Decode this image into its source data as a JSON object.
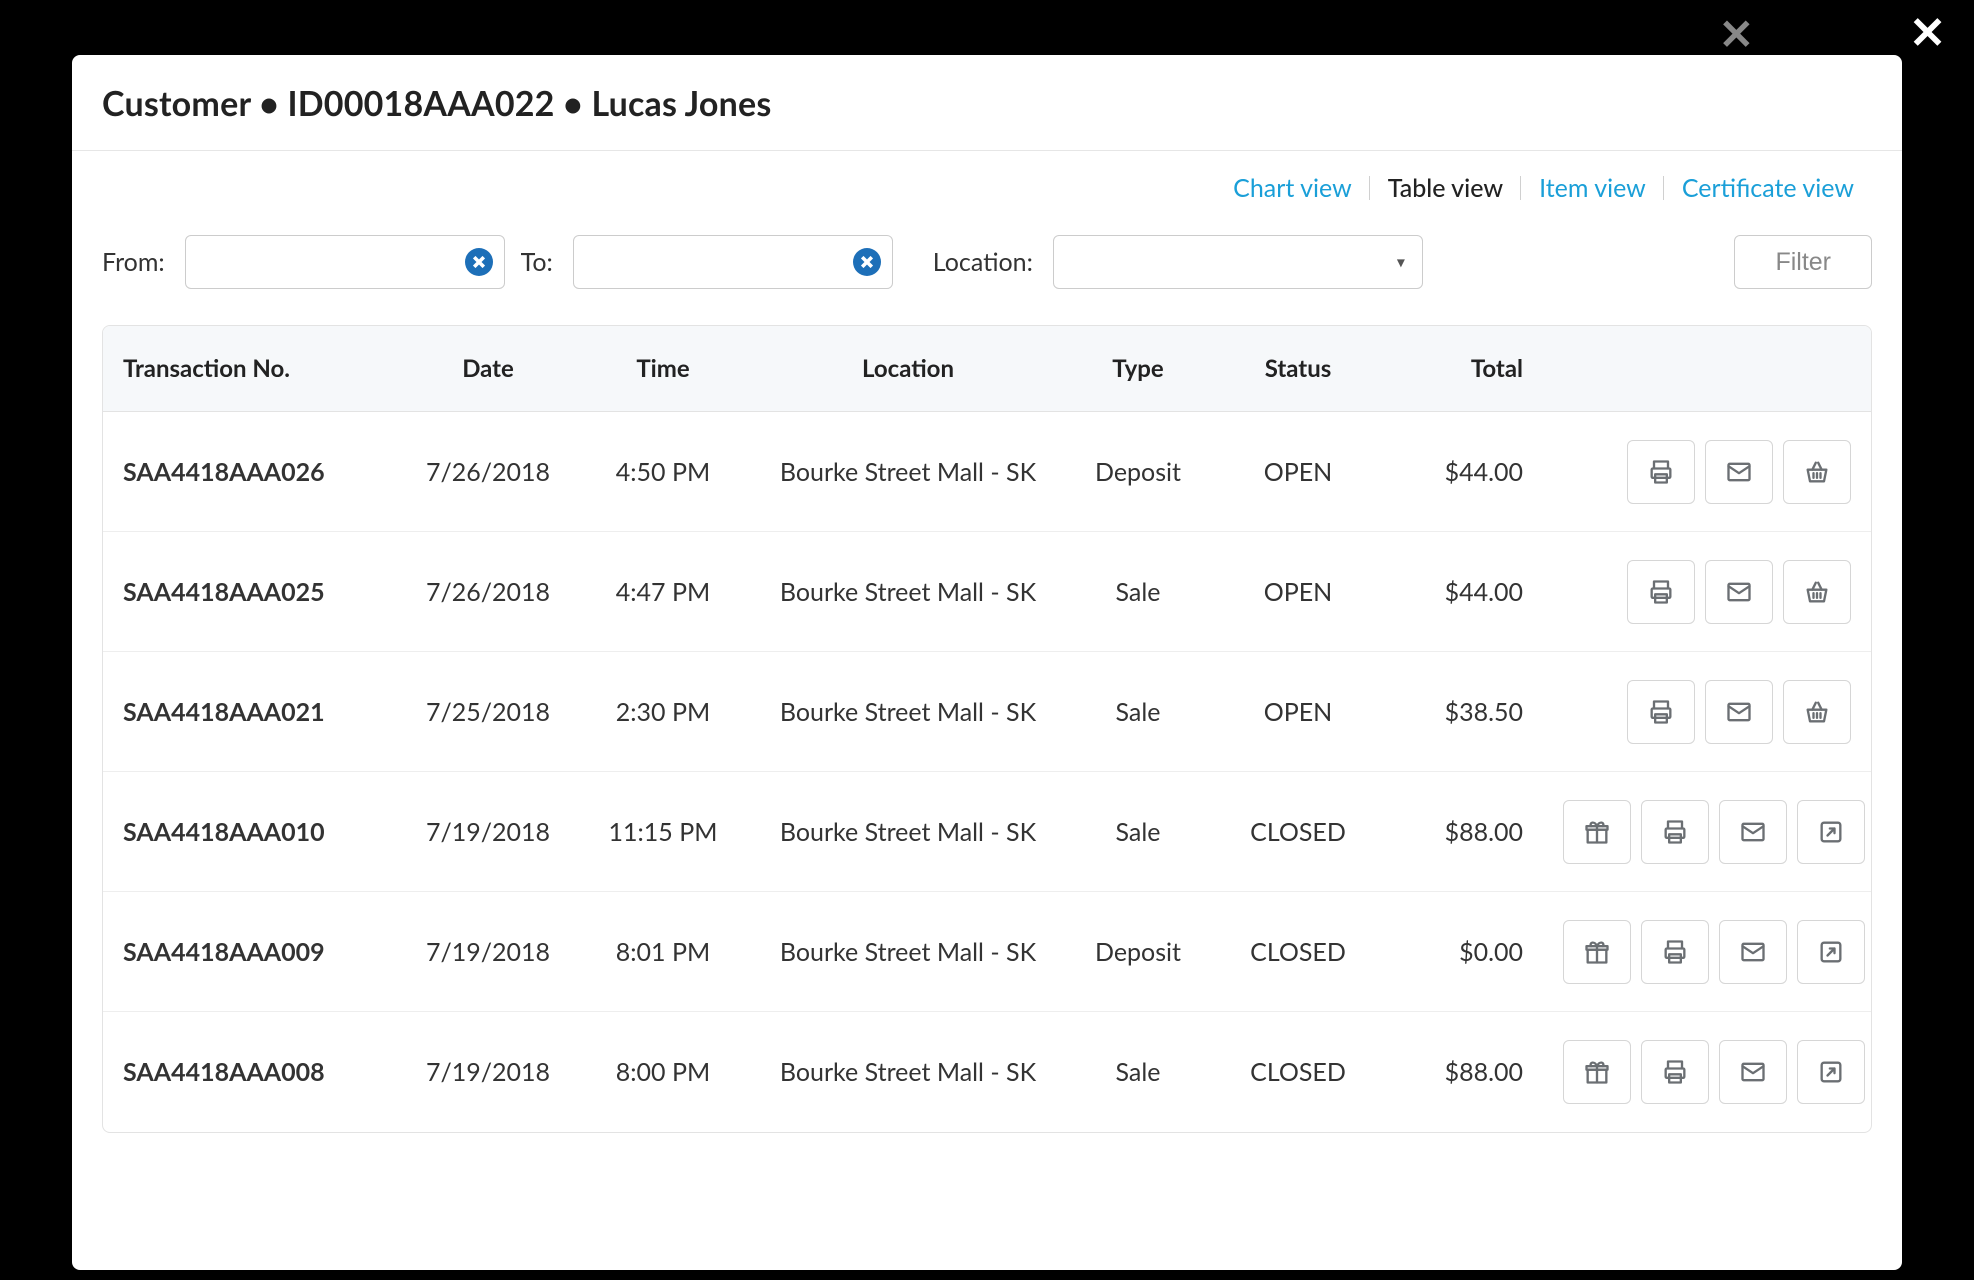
{
  "modal": {
    "title": "Customer • ID00018AAA022 • Lucas Jones"
  },
  "tabs": {
    "chart": "Chart view",
    "table": "Table view",
    "item": "Item view",
    "certificate": "Certificate view",
    "active": "table"
  },
  "filters": {
    "from_label": "From:",
    "to_label": "To:",
    "location_label": "Location:",
    "filter_button": "Filter",
    "from_value": "",
    "to_value": "",
    "location_value": ""
  },
  "table": {
    "headers": {
      "txno": "Transaction No.",
      "date": "Date",
      "time": "Time",
      "location": "Location",
      "type": "Type",
      "status": "Status",
      "total": "Total"
    },
    "rows": [
      {
        "txno": "SAA4418AAA026",
        "date": "7/26/2018",
        "time": "4:50 PM",
        "location": "Bourke Street Mall - SK",
        "type": "Deposit",
        "status": "OPEN",
        "total": "$44.00",
        "actions": [
          "print",
          "email",
          "basket"
        ]
      },
      {
        "txno": "SAA4418AAA025",
        "date": "7/26/2018",
        "time": "4:47 PM",
        "location": "Bourke Street Mall - SK",
        "type": "Sale",
        "status": "OPEN",
        "total": "$44.00",
        "actions": [
          "print",
          "email",
          "basket"
        ]
      },
      {
        "txno": "SAA4418AAA021",
        "date": "7/25/2018",
        "time": "2:30 PM",
        "location": "Bourke Street Mall - SK",
        "type": "Sale",
        "status": "OPEN",
        "total": "$38.50",
        "actions": [
          "print",
          "email",
          "basket"
        ]
      },
      {
        "txno": "SAA4418AAA010",
        "date": "7/19/2018",
        "time": "11:15 PM",
        "location": "Bourke Street Mall - SK",
        "type": "Sale",
        "status": "CLOSED",
        "total": "$88.00",
        "actions": [
          "gift",
          "print",
          "email",
          "open"
        ]
      },
      {
        "txno": "SAA4418AAA009",
        "date": "7/19/2018",
        "time": "8:01 PM",
        "location": "Bourke Street Mall - SK",
        "type": "Deposit",
        "status": "CLOSED",
        "total": "$0.00",
        "actions": [
          "gift",
          "print",
          "email",
          "open"
        ]
      },
      {
        "txno": "SAA4418AAA008",
        "date": "7/19/2018",
        "time": "8:00 PM",
        "location": "Bourke Street Mall - SK",
        "type": "Sale",
        "status": "CLOSED",
        "total": "$88.00",
        "actions": [
          "gift",
          "print",
          "email",
          "open"
        ]
      }
    ]
  },
  "icon_names": {
    "print": "print-icon",
    "email": "email-icon",
    "basket": "basket-icon",
    "gift": "gift-icon",
    "open": "open-external-icon"
  }
}
